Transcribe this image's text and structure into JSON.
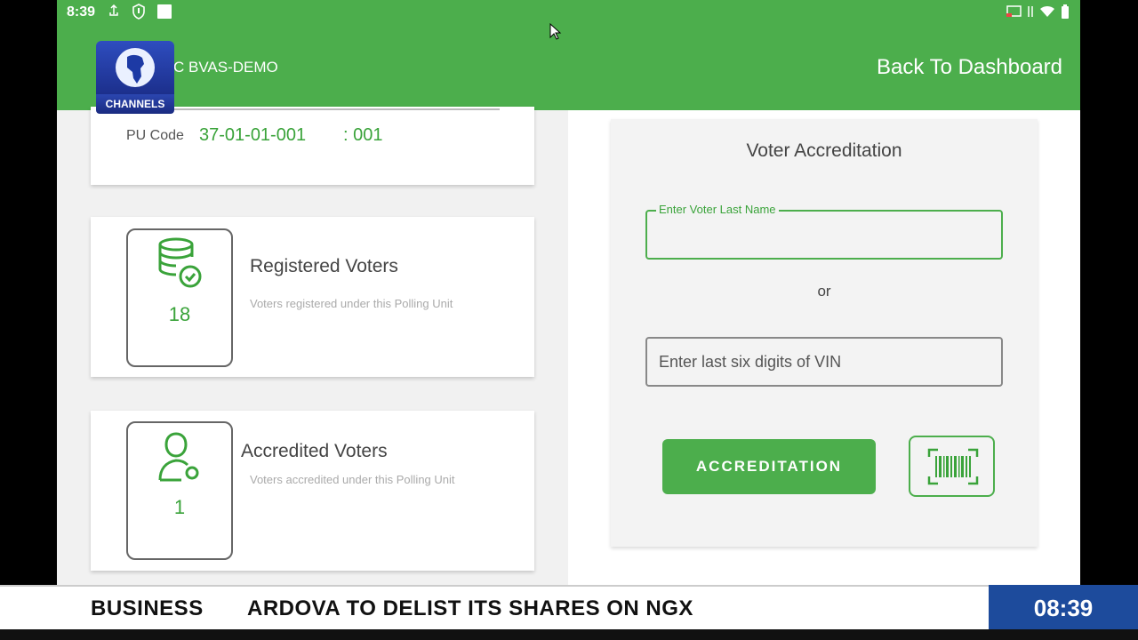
{
  "status_bar": {
    "time": "8:39"
  },
  "app_bar": {
    "title": "C BVAS-DEMO",
    "back_label": "Back To Dashboard",
    "color": "#4cae4c"
  },
  "pu_card": {
    "label": "PU Code",
    "code": "37-01-01-001",
    "sub": ": 001"
  },
  "registered": {
    "count": "18",
    "title": "Registered Voters",
    "subtitle": "Voters registered under this Polling Unit",
    "icon": "database-check-icon"
  },
  "accredited": {
    "count": "1",
    "title": "Accredited Voters",
    "subtitle": "Voters accredited under this Polling Unit",
    "icon": "user-icon"
  },
  "accreditation_form": {
    "title": "Voter Accreditation",
    "lastname_label": "Enter Voter Last Name",
    "lastname_value": "",
    "or_text": "or",
    "vin_placeholder": "Enter last six digits of VIN",
    "button_label": "ACCREDITATION",
    "scan_icon": "barcode-scan-icon"
  },
  "logo": {
    "text": "CHANNELS"
  },
  "ticker": {
    "section": "BUSINESS",
    "headline": "ARDOVA TO DELIST ITS SHARES ON NGX",
    "clock": "08:39",
    "clock_color": "#1d4b9c"
  }
}
